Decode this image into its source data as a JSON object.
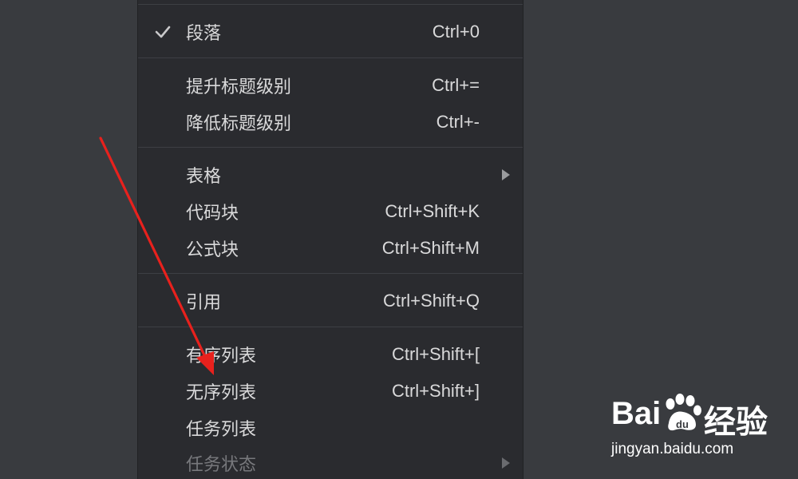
{
  "menu": {
    "items": [
      {
        "label": "段落",
        "shortcut": "Ctrl+0",
        "checked": true
      },
      {
        "label": "提升标题级别",
        "shortcut": "Ctrl+="
      },
      {
        "label": "降低标题级别",
        "shortcut": "Ctrl+-"
      },
      {
        "label": "表格",
        "shortcut": "",
        "submenu": true
      },
      {
        "label": "代码块",
        "shortcut": "Ctrl+Shift+K"
      },
      {
        "label": "公式块",
        "shortcut": "Ctrl+Shift+M"
      },
      {
        "label": "引用",
        "shortcut": "Ctrl+Shift+Q"
      },
      {
        "label": "有序列表",
        "shortcut": "Ctrl+Shift+["
      },
      {
        "label": "无序列表",
        "shortcut": "Ctrl+Shift+]"
      },
      {
        "label": "任务列表",
        "shortcut": ""
      },
      {
        "label": "任务状态",
        "shortcut": "",
        "submenu": true,
        "disabled": true
      }
    ]
  },
  "icons": {
    "check": "check-icon",
    "submenu": "chevron-right-icon",
    "annotation": "red-arrow-annotation"
  },
  "colors": {
    "background": "#393b3f",
    "menu_background": "#2a2b2f",
    "text": "#d9d9da",
    "disabled_text": "#77787c",
    "annotation": "#e8211d"
  },
  "watermark": {
    "brand_left": "Bai",
    "brand_right": "经验",
    "url": "jingyan.baidu.com"
  }
}
